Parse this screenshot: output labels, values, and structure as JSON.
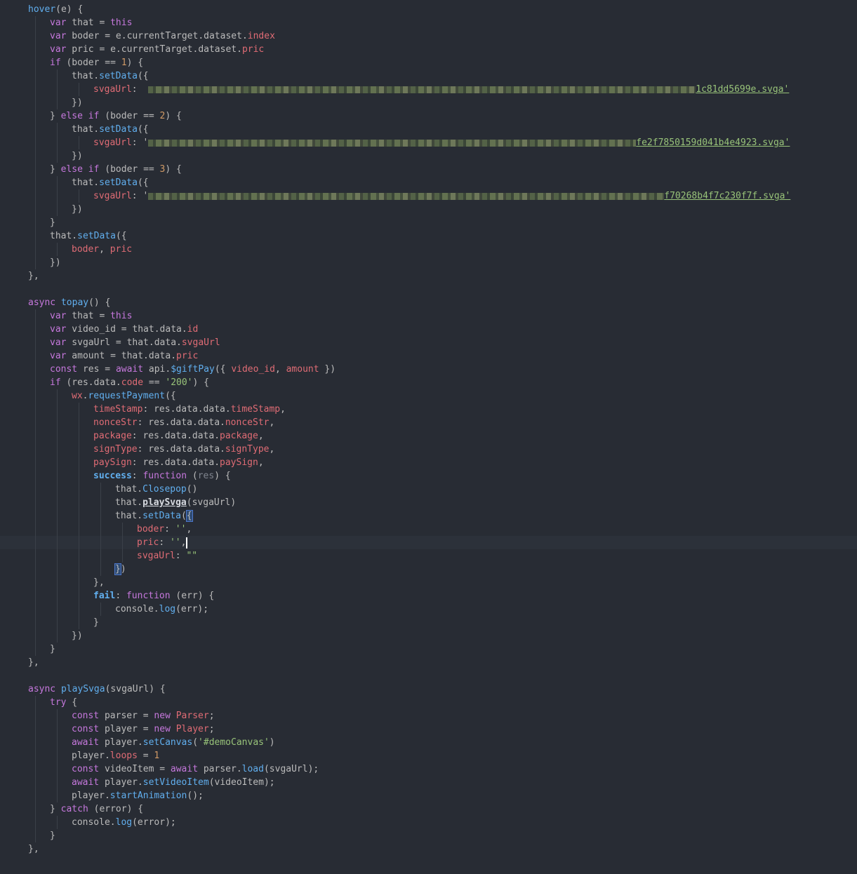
{
  "editor": {
    "theme_background": "#282c34",
    "cursor_line": 40,
    "lines": [
      {
        "indent": 0,
        "tokens": [
          [
            "fn",
            "hover"
          ],
          [
            "pl",
            "(e) {"
          ]
        ]
      },
      {
        "indent": 1,
        "tokens": [
          [
            "kw",
            "var"
          ],
          [
            "pl",
            " that = "
          ],
          [
            "kw",
            "this"
          ]
        ]
      },
      {
        "indent": 1,
        "tokens": [
          [
            "kw",
            "var"
          ],
          [
            "pl",
            " boder = e.currentTarget.dataset."
          ],
          [
            "pr",
            "index"
          ]
        ]
      },
      {
        "indent": 1,
        "tokens": [
          [
            "kw",
            "var"
          ],
          [
            "pl",
            " pric = e.currentTarget.dataset."
          ],
          [
            "pr",
            "pric"
          ]
        ]
      },
      {
        "indent": 1,
        "tokens": [
          [
            "kw",
            "if"
          ],
          [
            "pl",
            " (boder == "
          ],
          [
            "nm",
            "1"
          ],
          [
            "pl",
            ") {"
          ]
        ]
      },
      {
        "indent": 2,
        "tokens": [
          [
            "pl",
            "that."
          ],
          [
            "fn",
            "setData"
          ],
          [
            "pl",
            "({"
          ]
        ]
      },
      {
        "indent": 3,
        "tokens": [
          [
            "pr",
            "svgaUrl"
          ],
          [
            "pl",
            ":  "
          ],
          [
            "blur",
            "780"
          ],
          [
            "st",
            "1c81dd5699e.svga'"
          ]
        ]
      },
      {
        "indent": 2,
        "tokens": [
          [
            "pl",
            "})"
          ]
        ]
      },
      {
        "indent": 1,
        "tokens": [
          [
            "pl",
            "} "
          ],
          [
            "kw",
            "else if"
          ],
          [
            "pl",
            " (boder == "
          ],
          [
            "nm",
            "2"
          ],
          [
            "pl",
            ") {"
          ]
        ]
      },
      {
        "indent": 2,
        "tokens": [
          [
            "pl",
            "that."
          ],
          [
            "fn",
            "setData"
          ],
          [
            "pl",
            "({"
          ]
        ]
      },
      {
        "indent": 3,
        "tokens": [
          [
            "pr",
            "svgaUrl"
          ],
          [
            "pl",
            ": '"
          ],
          [
            "blur",
            "695"
          ],
          [
            "st",
            "fe2f7850159d041b4e4923.svga'"
          ]
        ]
      },
      {
        "indent": 2,
        "tokens": [
          [
            "pl",
            "})"
          ]
        ]
      },
      {
        "indent": 1,
        "tokens": [
          [
            "pl",
            "} "
          ],
          [
            "kw",
            "else if"
          ],
          [
            "pl",
            " (boder == "
          ],
          [
            "nm",
            "3"
          ],
          [
            "pl",
            ") {"
          ]
        ]
      },
      {
        "indent": 2,
        "tokens": [
          [
            "pl",
            "that."
          ],
          [
            "fn",
            "setData"
          ],
          [
            "pl",
            "({"
          ]
        ]
      },
      {
        "indent": 3,
        "tokens": [
          [
            "pr",
            "svgaUrl"
          ],
          [
            "pl",
            ": '"
          ],
          [
            "blur",
            "735"
          ],
          [
            "st",
            "f70268b4f7c230f7f.svga'"
          ]
        ]
      },
      {
        "indent": 2,
        "tokens": [
          [
            "pl",
            "})"
          ]
        ]
      },
      {
        "indent": 1,
        "tokens": [
          [
            "pl",
            "}"
          ]
        ]
      },
      {
        "indent": 1,
        "tokens": [
          [
            "pl",
            "that."
          ],
          [
            "fn",
            "setData"
          ],
          [
            "pl",
            "({"
          ]
        ]
      },
      {
        "indent": 2,
        "tokens": [
          [
            "pr",
            "boder"
          ],
          [
            "pl",
            ", "
          ],
          [
            "pr",
            "pric"
          ]
        ]
      },
      {
        "indent": 1,
        "tokens": [
          [
            "pl",
            "})"
          ]
        ]
      },
      {
        "indent": 0,
        "tokens": [
          [
            "pl",
            "},"
          ]
        ]
      },
      {
        "indent": 0,
        "tokens": []
      },
      {
        "indent": 0,
        "tokens": [
          [
            "kw",
            "async"
          ],
          [
            "pl",
            " "
          ],
          [
            "fn",
            "topay"
          ],
          [
            "pl",
            "() {"
          ]
        ]
      },
      {
        "indent": 1,
        "tokens": [
          [
            "kw",
            "var"
          ],
          [
            "pl",
            " that = "
          ],
          [
            "kw",
            "this"
          ]
        ]
      },
      {
        "indent": 1,
        "tokens": [
          [
            "kw",
            "var"
          ],
          [
            "pl",
            " video_id = that.data."
          ],
          [
            "pr",
            "id"
          ]
        ]
      },
      {
        "indent": 1,
        "tokens": [
          [
            "kw",
            "var"
          ],
          [
            "pl",
            " svgaUrl = that.data."
          ],
          [
            "pr",
            "svgaUrl"
          ]
        ]
      },
      {
        "indent": 1,
        "tokens": [
          [
            "kw",
            "var"
          ],
          [
            "pl",
            " amount = that.data."
          ],
          [
            "pr",
            "pric"
          ]
        ]
      },
      {
        "indent": 1,
        "tokens": [
          [
            "kw",
            "const"
          ],
          [
            "pl",
            " res = "
          ],
          [
            "kw",
            "await"
          ],
          [
            "pl",
            " api."
          ],
          [
            "fn",
            "$giftPay"
          ],
          [
            "pl",
            "({ "
          ],
          [
            "pr",
            "video_id"
          ],
          [
            "pl",
            ", "
          ],
          [
            "pr",
            "amount"
          ],
          [
            "pl",
            " })"
          ]
        ]
      },
      {
        "indent": 1,
        "tokens": [
          [
            "kw",
            "if"
          ],
          [
            "pl",
            " (res.data."
          ],
          [
            "pr",
            "code"
          ],
          [
            "pl",
            " == "
          ],
          [
            "st",
            "'200'"
          ],
          [
            "pl",
            ") {"
          ]
        ]
      },
      {
        "indent": 2,
        "tokens": [
          [
            "pr",
            "wx"
          ],
          [
            "pl",
            "."
          ],
          [
            "fn",
            "requestPayment"
          ],
          [
            "pl",
            "({"
          ]
        ]
      },
      {
        "indent": 3,
        "tokens": [
          [
            "pr",
            "timeStamp"
          ],
          [
            "pl",
            ": res.data.data."
          ],
          [
            "pr",
            "timeStamp"
          ],
          [
            "pl",
            ","
          ]
        ]
      },
      {
        "indent": 3,
        "tokens": [
          [
            "pr",
            "nonceStr"
          ],
          [
            "pl",
            ": res.data.data."
          ],
          [
            "pr",
            "nonceStr"
          ],
          [
            "pl",
            ","
          ]
        ]
      },
      {
        "indent": 3,
        "tokens": [
          [
            "pr",
            "package"
          ],
          [
            "pl",
            ": res.data.data."
          ],
          [
            "pr",
            "package"
          ],
          [
            "pl",
            ","
          ]
        ]
      },
      {
        "indent": 3,
        "tokens": [
          [
            "pr",
            "signType"
          ],
          [
            "pl",
            ": res.data.data."
          ],
          [
            "pr",
            "signType"
          ],
          [
            "pl",
            ","
          ]
        ]
      },
      {
        "indent": 3,
        "tokens": [
          [
            "pr",
            "paySign"
          ],
          [
            "pl",
            ": res.data.data."
          ],
          [
            "pr",
            "paySign"
          ],
          [
            "pl",
            ","
          ]
        ]
      },
      {
        "indent": 3,
        "tokens": [
          [
            "fnb",
            "success"
          ],
          [
            "pl",
            ": "
          ],
          [
            "kw",
            "function"
          ],
          [
            "pl",
            " ("
          ],
          [
            "dim",
            "res"
          ],
          [
            "pl",
            ") {"
          ]
        ]
      },
      {
        "indent": 4,
        "tokens": [
          [
            "pl",
            "that."
          ],
          [
            "fn",
            "Closepop"
          ],
          [
            "pl",
            "()"
          ]
        ]
      },
      {
        "indent": 4,
        "tokens": [
          [
            "pl",
            "that."
          ],
          [
            "bu",
            "playSvga"
          ],
          [
            "pl",
            "(svgaUrl)"
          ]
        ]
      },
      {
        "indent": 4,
        "tokens": [
          [
            "pl",
            "that."
          ],
          [
            "fn",
            "setData"
          ],
          [
            "pl",
            "("
          ],
          [
            "hl",
            "{"
          ]
        ]
      },
      {
        "indent": 5,
        "tokens": [
          [
            "pr",
            "boder"
          ],
          [
            "pl",
            ": "
          ],
          [
            "st",
            "''"
          ],
          [
            "pl",
            ","
          ]
        ]
      },
      {
        "indent": 5,
        "tokens": [
          [
            "pr",
            "pric"
          ],
          [
            "pl",
            ": "
          ],
          [
            "st",
            "''"
          ],
          [
            "pl",
            ","
          ],
          [
            "caret",
            ""
          ]
        ]
      },
      {
        "indent": 5,
        "tokens": [
          [
            "pr",
            "svgaUrl"
          ],
          [
            "pl",
            ": "
          ],
          [
            "st",
            "\"\""
          ]
        ]
      },
      {
        "indent": 4,
        "tokens": [
          [
            "hl",
            "}"
          ],
          [
            "pl",
            ")"
          ]
        ]
      },
      {
        "indent": 3,
        "tokens": [
          [
            "pl",
            "},"
          ]
        ]
      },
      {
        "indent": 3,
        "tokens": [
          [
            "fnb",
            "fail"
          ],
          [
            "pl",
            ": "
          ],
          [
            "kw",
            "function"
          ],
          [
            "pl",
            " (err) {"
          ]
        ]
      },
      {
        "indent": 4,
        "tokens": [
          [
            "pl",
            "console."
          ],
          [
            "fn",
            "log"
          ],
          [
            "pl",
            "(err);"
          ]
        ]
      },
      {
        "indent": 3,
        "tokens": [
          [
            "pl",
            "}"
          ]
        ]
      },
      {
        "indent": 2,
        "tokens": [
          [
            "pl",
            "})"
          ]
        ]
      },
      {
        "indent": 1,
        "tokens": [
          [
            "pl",
            "}"
          ]
        ]
      },
      {
        "indent": 0,
        "tokens": [
          [
            "pl",
            "},"
          ]
        ]
      },
      {
        "indent": 0,
        "tokens": []
      },
      {
        "indent": 0,
        "tokens": [
          [
            "kw",
            "async"
          ],
          [
            "pl",
            " "
          ],
          [
            "fn",
            "playSvga"
          ],
          [
            "pl",
            "(svgaUrl) {"
          ]
        ]
      },
      {
        "indent": 1,
        "tokens": [
          [
            "kw",
            "try"
          ],
          [
            "pl",
            " {"
          ]
        ]
      },
      {
        "indent": 2,
        "tokens": [
          [
            "kw",
            "const"
          ],
          [
            "pl",
            " parser = "
          ],
          [
            "kw",
            "new"
          ],
          [
            "pl",
            " "
          ],
          [
            "pr",
            "Parser"
          ],
          [
            "pl",
            ";"
          ]
        ]
      },
      {
        "indent": 2,
        "tokens": [
          [
            "kw",
            "const"
          ],
          [
            "pl",
            " player = "
          ],
          [
            "kw",
            "new"
          ],
          [
            "pl",
            " "
          ],
          [
            "pr",
            "Player"
          ],
          [
            "pl",
            ";"
          ]
        ]
      },
      {
        "indent": 2,
        "tokens": [
          [
            "kw",
            "await"
          ],
          [
            "pl",
            " player."
          ],
          [
            "fn",
            "setCanvas"
          ],
          [
            "pl",
            "("
          ],
          [
            "st",
            "'#demoCanvas'"
          ],
          [
            "pl",
            ")"
          ]
        ]
      },
      {
        "indent": 2,
        "tokens": [
          [
            "pl",
            "player."
          ],
          [
            "pr",
            "loops"
          ],
          [
            "pl",
            " = "
          ],
          [
            "nm",
            "1"
          ]
        ]
      },
      {
        "indent": 2,
        "tokens": [
          [
            "kw",
            "const"
          ],
          [
            "pl",
            " videoItem = "
          ],
          [
            "kw",
            "await"
          ],
          [
            "pl",
            " parser."
          ],
          [
            "fn",
            "load"
          ],
          [
            "pl",
            "(svgaUrl);"
          ]
        ]
      },
      {
        "indent": 2,
        "tokens": [
          [
            "kw",
            "await"
          ],
          [
            "pl",
            " player."
          ],
          [
            "fn",
            "setVideoItem"
          ],
          [
            "pl",
            "(videoItem);"
          ]
        ]
      },
      {
        "indent": 2,
        "tokens": [
          [
            "pl",
            "player."
          ],
          [
            "fn",
            "startAnimation"
          ],
          [
            "pl",
            "();"
          ]
        ]
      },
      {
        "indent": 1,
        "tokens": [
          [
            "pl",
            "} "
          ],
          [
            "kw",
            "catch"
          ],
          [
            "pl",
            " (error) {"
          ]
        ]
      },
      {
        "indent": 2,
        "tokens": [
          [
            "pl",
            "console."
          ],
          [
            "fn",
            "log"
          ],
          [
            "pl",
            "(error);"
          ]
        ]
      },
      {
        "indent": 1,
        "tokens": [
          [
            "pl",
            "}"
          ]
        ]
      },
      {
        "indent": 0,
        "tokens": [
          [
            "pl",
            "},"
          ]
        ]
      }
    ]
  }
}
